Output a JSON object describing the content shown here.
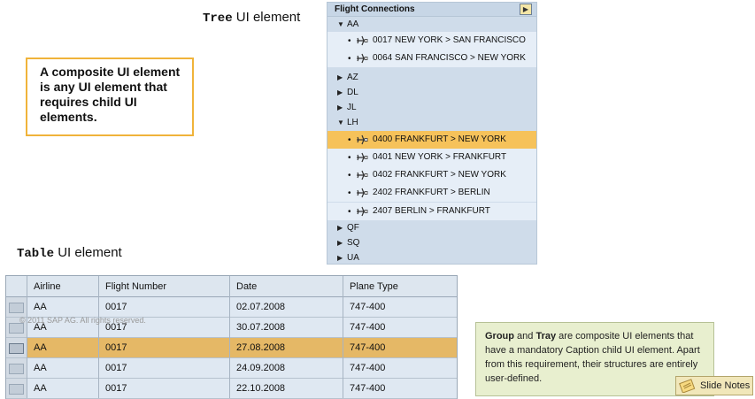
{
  "tree_caption": {
    "mono": "Tree",
    "rest": "UI element"
  },
  "table_caption": {
    "mono": "Table",
    "rest": "UI element"
  },
  "callout": {
    "text": "A composite UI element is any UI element that requires child UI elements."
  },
  "tree": {
    "title": "Flight Connections",
    "pin_icon": "pin-icon",
    "rows": [
      {
        "kind": "cat",
        "expanded": true,
        "label": "AA"
      },
      {
        "kind": "leaf",
        "label": "0017 NEW YORK > SAN FRANCISCO",
        "selected": false
      },
      {
        "kind": "leaf",
        "label": "0064 SAN FRANCISCO > NEW YORK",
        "selected": false
      },
      {
        "kind": "cat",
        "expanded": false,
        "label": "AZ"
      },
      {
        "kind": "cat",
        "expanded": false,
        "label": "DL"
      },
      {
        "kind": "cat",
        "expanded": false,
        "label": "JL"
      },
      {
        "kind": "cat",
        "expanded": true,
        "label": "LH"
      },
      {
        "kind": "leaf",
        "label": "0400 FRANKFURT > NEW YORK",
        "selected": true
      },
      {
        "kind": "leaf",
        "label": "0401 NEW YORK > FRANKFURT",
        "selected": false
      },
      {
        "kind": "leaf",
        "label": "0402 FRANKFURT > NEW YORK",
        "selected": false
      },
      {
        "kind": "leaf",
        "label": "2402 FRANKFURT > BERLIN",
        "selected": false
      },
      {
        "kind": "leaf",
        "label": "2407 BERLIN > FRANKFURT",
        "selected": false
      },
      {
        "kind": "cat",
        "expanded": false,
        "label": "QF"
      },
      {
        "kind": "cat",
        "expanded": false,
        "label": "SQ"
      },
      {
        "kind": "cat",
        "expanded": false,
        "label": "UA"
      }
    ]
  },
  "table": {
    "columns": [
      "Airline",
      "Flight Number",
      "Date",
      "Plane Type"
    ],
    "rows": [
      {
        "cells": [
          "AA",
          "0017",
          "02.07.2008",
          "747-400"
        ],
        "selected": false
      },
      {
        "cells": [
          "AA",
          "0017",
          "30.07.2008",
          "747-400"
        ],
        "selected": false
      },
      {
        "cells": [
          "AA",
          "0017",
          "27.08.2008",
          "747-400"
        ],
        "selected": true
      },
      {
        "cells": [
          "AA",
          "0017",
          "24.09.2008",
          "747-400"
        ],
        "selected": false
      },
      {
        "cells": [
          "AA",
          "0017",
          "22.10.2008",
          "747-400"
        ],
        "selected": false
      }
    ]
  },
  "copyright": "© 2011 SAP AG. All rights reserved.",
  "note": {
    "bold1": "Group",
    "t1": " and ",
    "bold2": "Tray",
    "t2": " are composite UI elements that have a mandatory Caption child UI element. Apart from this requirement, their structures are entirely user-defined."
  },
  "slide_notes": {
    "label": "Slide Notes",
    "icon": "notes-icon"
  },
  "colors": {
    "tree_bg": "#cfdcea",
    "selection": "#f6c25a",
    "table_selection": "#e5b866",
    "callout_border": "#f0b33a",
    "note_bg": "#e8efcf"
  }
}
